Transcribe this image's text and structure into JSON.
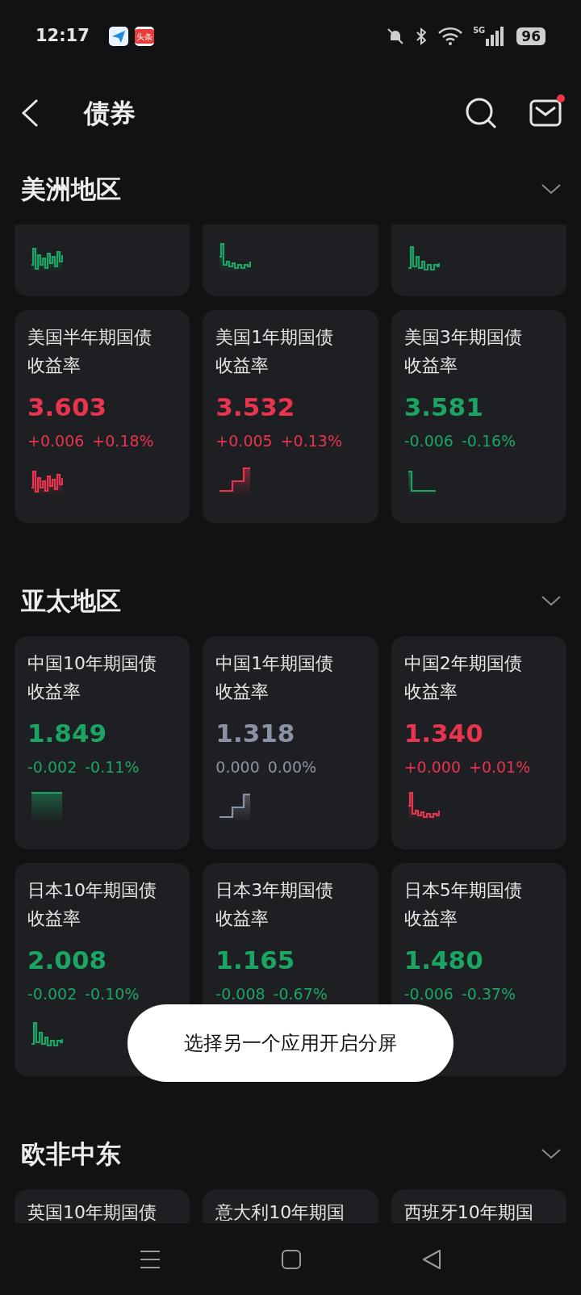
{
  "status_bar": {
    "time": "12:17",
    "app_badge": "头条",
    "battery": "96",
    "network": "5G"
  },
  "header": {
    "title": "债券",
    "mail_unread": true
  },
  "sections": [
    {
      "title": "美洲地区",
      "rows": [
        [
          {
            "kind": "tail",
            "color": "#1aa564"
          },
          {
            "kind": "tail",
            "color": "#1aa564"
          },
          {
            "kind": "tail",
            "color": "#1aa564"
          }
        ],
        [
          {
            "kind": "full",
            "name": "美国半年期国债收益率",
            "value": "3.603",
            "change": "+0.006",
            "change_pct": "+0.18%",
            "color": "#e8344e"
          },
          {
            "kind": "full",
            "name": "美国1年期国债收益率",
            "value": "3.532",
            "change": "+0.005",
            "change_pct": "+0.13%",
            "color": "#e8344e"
          },
          {
            "kind": "full",
            "name": "美国3年期国债收益率",
            "value": "3.581",
            "change": "-0.006",
            "change_pct": "-0.16%",
            "color": "#1aa564"
          }
        ]
      ]
    },
    {
      "title": "亚太地区",
      "rows": [
        [
          {
            "kind": "full",
            "name": "中国10年期国债收益率",
            "value": "1.849",
            "change": "-0.002",
            "change_pct": "-0.11%",
            "color": "#1aa564"
          },
          {
            "kind": "full",
            "name": "中国1年期国债收益率",
            "value": "1.318",
            "change": "0.000",
            "change_pct": "0.00%",
            "color": "#8a93a6"
          },
          {
            "kind": "full",
            "name": "中国2年期国债收益率",
            "value": "1.340",
            "change": "+0.000",
            "change_pct": "+0.01%",
            "color": "#e8344e"
          }
        ],
        [
          {
            "kind": "full",
            "name": "日本10年期国债收益率",
            "value": "2.008",
            "change": "-0.002",
            "change_pct": "-0.10%",
            "color": "#1aa564"
          },
          {
            "kind": "covered",
            "name": "日本3年期国债收益率",
            "value": "1.165",
            "change": "-0.008",
            "change_pct": "-0.67%",
            "color": "#1aa564"
          },
          {
            "kind": "covered",
            "name": "日本5年期国债收益率",
            "value": "1.480",
            "change": "-0.006",
            "change_pct": "-0.37%",
            "color": "#1aa564"
          }
        ]
      ]
    },
    {
      "title": "欧非中东",
      "rows": [
        [
          {
            "kind": "head",
            "name": "英国10年期国债"
          },
          {
            "kind": "head",
            "name": "意大利10年期国"
          },
          {
            "kind": "head",
            "name": "西班牙10年期国"
          }
        ]
      ]
    }
  ],
  "toast": "选择另一个应用开启分屏"
}
